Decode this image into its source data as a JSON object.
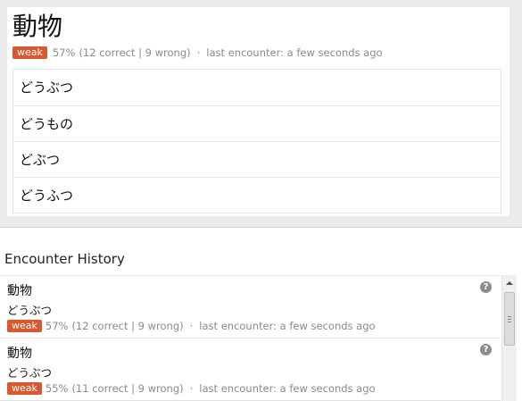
{
  "question": {
    "kanji": "動物",
    "badge": "weak",
    "percent": "57%",
    "record": "(12 correct | 9 wrong)",
    "separator": "·",
    "last_encounter": "last encounter: a few seconds ago"
  },
  "options": [
    "どうぶつ",
    "どうもの",
    "どぶつ",
    "どうふつ"
  ],
  "history": {
    "heading": "Encounter History",
    "items": [
      {
        "kanji": "動物",
        "reading": "どうぶつ",
        "badge": "weak",
        "percent": "57%",
        "record": "(12 correct | 9 wrong)",
        "separator": "·",
        "last_encounter": "last encounter: a few seconds ago",
        "help": "?"
      },
      {
        "kanji": "動物",
        "reading": "どうぶつ",
        "badge": "weak",
        "percent": "55%",
        "record": "(11 correct | 9 wrong)",
        "separator": "·",
        "last_encounter": "last encounter: a few seconds ago",
        "help": "?"
      }
    ]
  },
  "colors": {
    "badge": "#d9582f",
    "muted_text": "#8a8a8a",
    "background": "#ebebeb"
  }
}
